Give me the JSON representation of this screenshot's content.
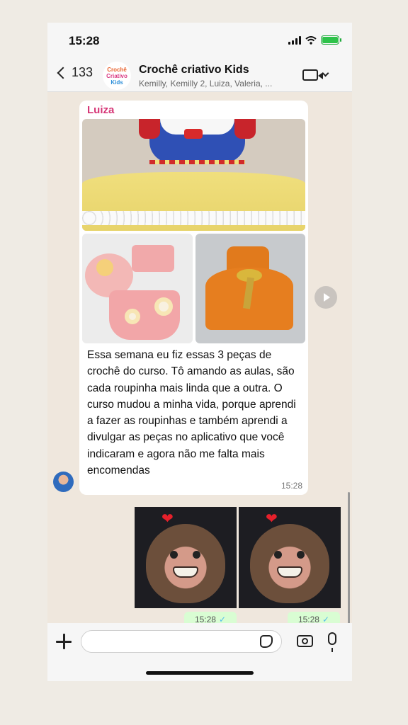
{
  "status": {
    "time": "15:28"
  },
  "header": {
    "back_count": "133",
    "avatar_lines": [
      "Crochê",
      "Criativo",
      "Kids"
    ],
    "group_name": "Crochê criativo Kids",
    "members": "Kemilly, Kemilly 2, Luiza, Valeria, ..."
  },
  "message": {
    "sender": "Luiza",
    "text": "Essa semana eu fiz essas 3 peças de crochê do curso. Tô amando as aulas, são cada roupinha mais linda que a outra. O curso mudou a minha vida, porque aprendi a fazer as roupinhas e também aprendi a divulgar as peças no aplicativo que você indicaram e agora não me falta mais encomendas",
    "time": "15:28"
  },
  "stickers": [
    {
      "heart": "❤",
      "time": "15:28",
      "check": "✓"
    },
    {
      "heart": "❤",
      "time": "15:28",
      "check": "✓"
    }
  ],
  "input": {
    "value": ""
  },
  "colors": {
    "sender_name": "#d63676",
    "sent_bubble": "#d9fdd3",
    "chat_bg": "#efe7dd"
  }
}
